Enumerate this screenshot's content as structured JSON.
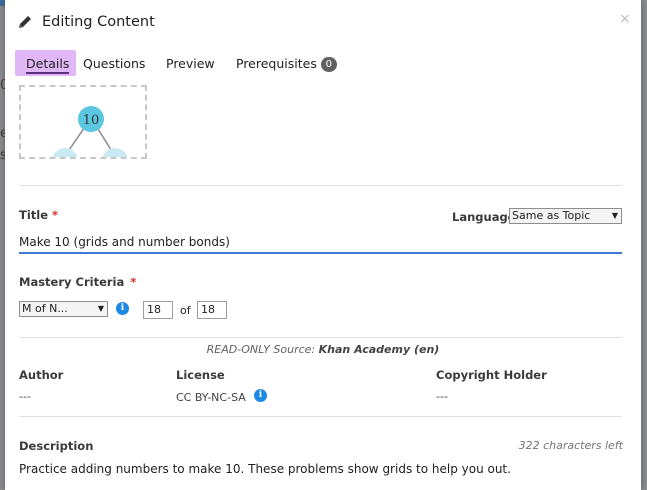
{
  "background": {
    "partial_texts": [
      "0",
      "e",
      "s"
    ]
  },
  "modal": {
    "title": "Editing Content",
    "close_label": "×",
    "icon": "pencil-icon"
  },
  "tabs": [
    {
      "label": "Details",
      "active": true
    },
    {
      "label": "Questions",
      "active": false
    },
    {
      "label": "Preview",
      "active": false
    },
    {
      "label": "Prerequisites",
      "badge": "0",
      "active": false
    }
  ],
  "thumbnail": {
    "node_label": "10"
  },
  "form": {
    "title_label": "Title",
    "title_required": "*",
    "title_value": "Make 10 (grids and number bonds)",
    "language_label": "Language",
    "language_value": "Same as Topic",
    "mastery_label": "Mastery Criteria",
    "mastery_required": "*",
    "mastery_type": "M of N...",
    "mastery_m": "18",
    "mastery_of": "of",
    "mastery_n": "18"
  },
  "source": {
    "prefix": "READ-ONLY Source:",
    "name": "Khan Academy (en)"
  },
  "metadata": {
    "author_label": "Author",
    "author_value": "---",
    "license_label": "License",
    "license_value": "CC BY-NC-SA",
    "copyright_label": "Copyright Holder",
    "copyright_value": "---"
  },
  "description": {
    "label": "Description",
    "count": "322 characters left",
    "text": "Practice adding numbers to make 10. These problems show grids to help you out."
  },
  "colors": {
    "accent_tab": "#e1b6f6",
    "input_underline": "#3a7bd5",
    "info_icon": "#1e88e5",
    "required": "#d32f2f"
  }
}
